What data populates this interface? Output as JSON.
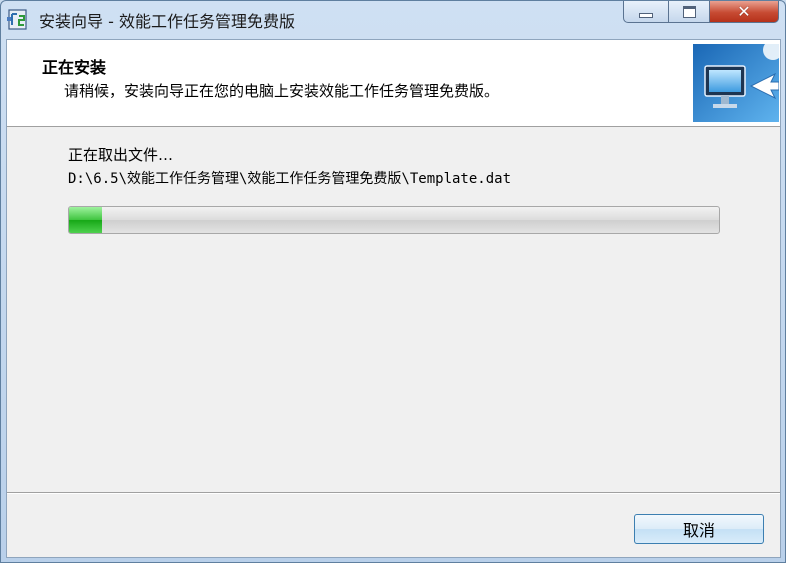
{
  "window": {
    "title": "安装向导 - 效能工作任务管理免费版",
    "app_icon": "installer-icon",
    "controls": {
      "minimize_icon": "minimize-icon",
      "maximize_icon": "maximize-icon",
      "close_glyph": "✕"
    }
  },
  "header": {
    "title": "正在安装",
    "subtitle": "请稍候，安装向导正在您的电脑上安装效能工作任务管理免费版。",
    "image_icon": "computer-install-icon"
  },
  "body": {
    "status_label": "正在取出文件…",
    "file_path": "D:\\6.5\\效能工作任务管理\\效能工作任务管理免费版\\Template.dat",
    "progress_fraction": 0.05
  },
  "footer": {
    "cancel_label": "取消"
  },
  "colors": {
    "progress_fill": "#2fbf2f",
    "close_button": "#c74b33",
    "button_border": "#3c7fb1"
  }
}
